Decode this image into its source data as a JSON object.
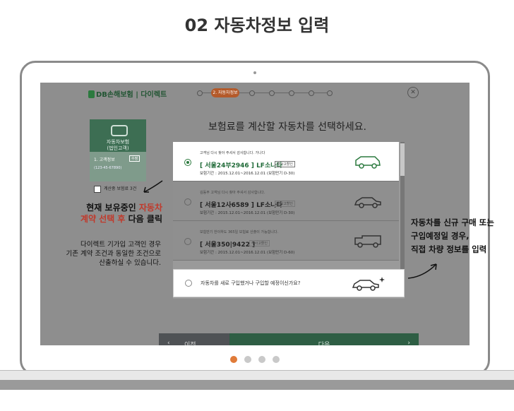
{
  "page_title": "02 자동차정보 입력",
  "app": {
    "logo_text": "DB손해보험 | 다이렉트",
    "steps": {
      "active_label": "2. 자동차정보",
      "total": 6,
      "active_index": 1
    },
    "close_icon": "close-icon"
  },
  "heading": "보험료를 계산할 자동차를 선택하세요.",
  "side_card": {
    "title_line1": "자동차보험",
    "title_line2": "(법인고객)",
    "customer_label": "1. 고객정보",
    "edit_label": "수정",
    "customer_detail": "(123-45-67890)",
    "checkbox_label": "계산중 보험료 3건"
  },
  "vehicles": [
    {
      "note": "고객님 다시 찾아 주셔서 감사합니다. 가나다",
      "plate": "[ 서울24부2946 ]",
      "model": "LF소나타",
      "badge": "무사고할인",
      "period": "보험기간 : 2015.12.01~2016.12.01 (보험만기 D-30)",
      "selected": true
    },
    {
      "note": "김동부 고객님 다시 찾아 주셔서 감사합니다.",
      "plate": "[ 서울12사6589 ]",
      "model": "LF소나타",
      "badge": "무사고할인",
      "period": "보험기간 : 2015.12.01~2016.12.01 (보험만기 D-30)",
      "selected": false
    },
    {
      "note": "보험만기 한이하도 365일 보험료 산출이 가능합니다.",
      "plate": "[ 서울350|9422 ]",
      "model": "",
      "badge": "무사고할인",
      "period": "보험기간 : 2015.12.01~2016.12.01 (보험만기 D-60)",
      "selected": false
    }
  ],
  "new_vehicle_question": "자동차를 새로 구입했거나 구입할 예정이신가요?",
  "buttons": {
    "prev": "이전",
    "next": "다음"
  },
  "annotations": {
    "left_line1": "현재 보유중인 ",
    "left_line1_red": "자동차",
    "left_line2_red": "계약 선택 후",
    "left_line2": " 다음 클릭",
    "left_small1": "다이렉트 기가입 고객인 경우",
    "left_small2": "기존 계약 조건과 동일한 조건으로",
    "left_small3": "산출하실 수 있습니다.",
    "right_line1": "자동차를 신규 구매 또는",
    "right_line2": "구입예정일 경우,",
    "right_line3": "직접 차량 정보를 입력"
  },
  "pager": {
    "count": 4,
    "active": 0
  },
  "colors": {
    "accent": "#e07b39",
    "brand_green": "#2c7a3f",
    "step_active": "#b45a2a"
  }
}
